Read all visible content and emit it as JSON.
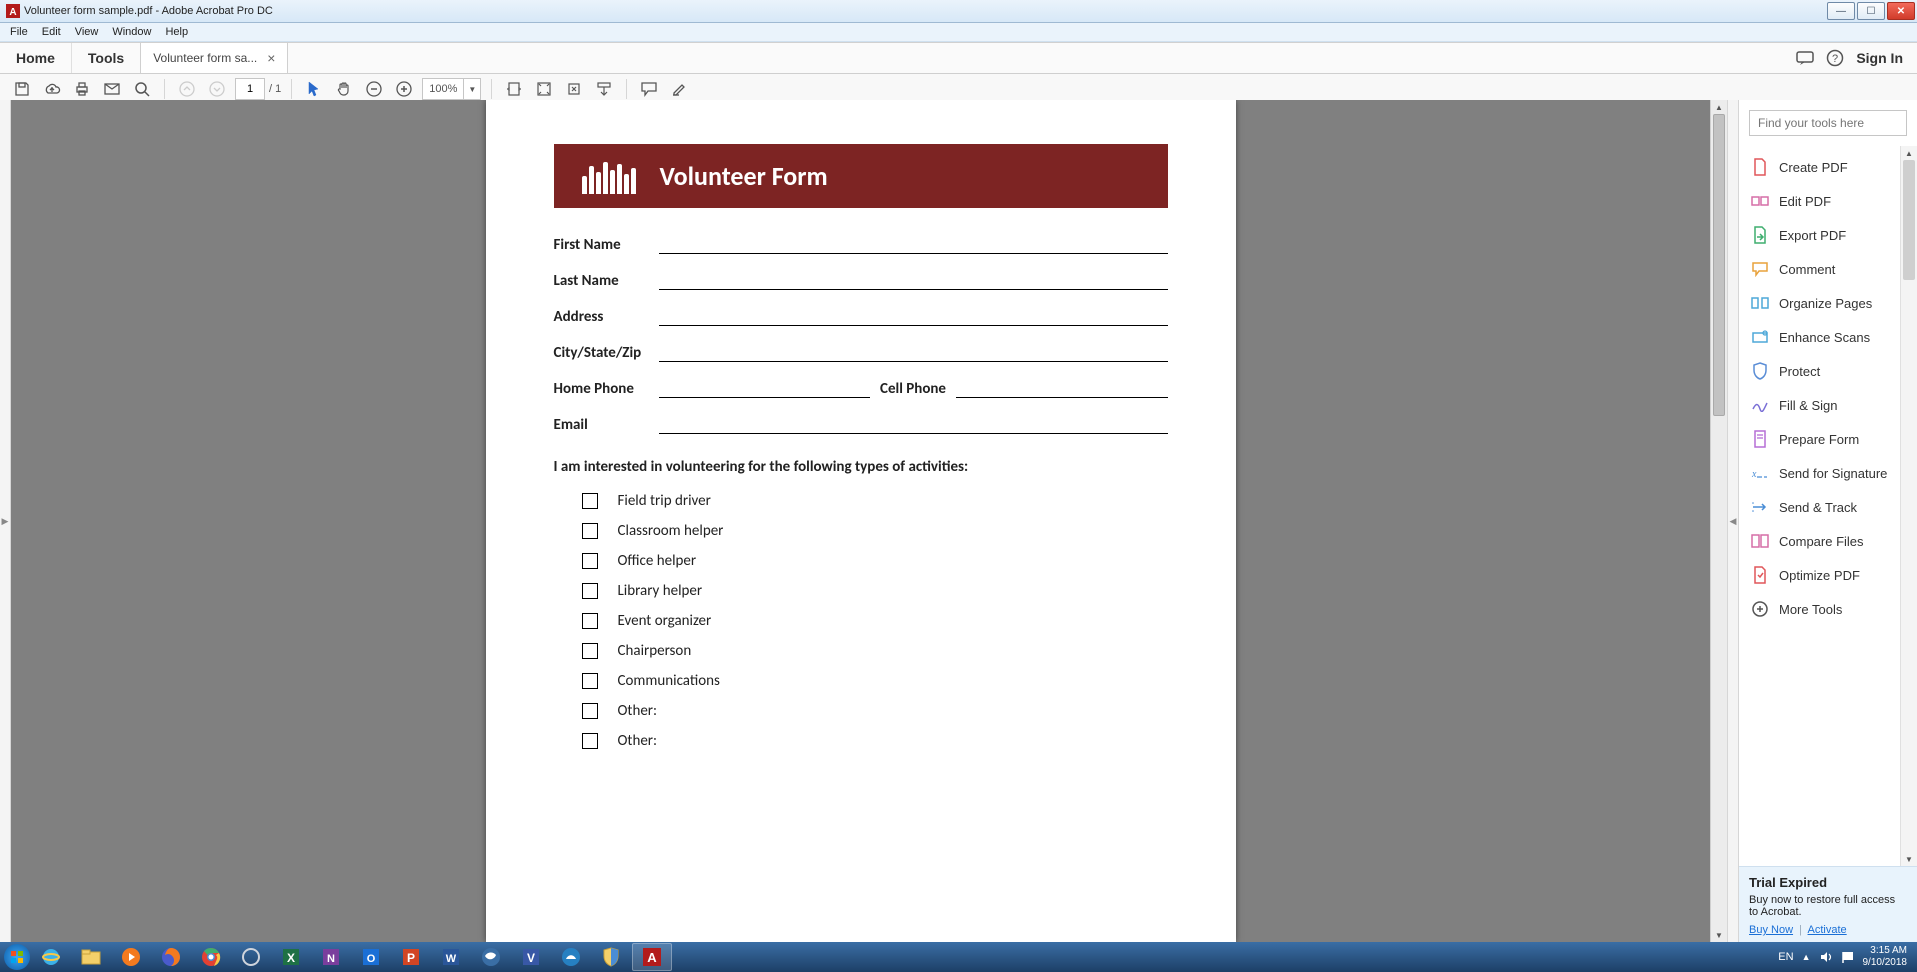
{
  "window": {
    "title": "Volunteer form sample.pdf - Adobe Acrobat Pro DC"
  },
  "menubar": [
    "File",
    "Edit",
    "View",
    "Window",
    "Help"
  ],
  "commandbar": {
    "home": "Home",
    "tools": "Tools",
    "tab_label": "Volunteer form sa...",
    "signin": "Sign In"
  },
  "toolbar": {
    "page_current": "1",
    "page_total": "/ 1",
    "zoom": "100%"
  },
  "pdf": {
    "banner_title": "Volunteer Form",
    "fields": {
      "first_name": "First Name",
      "last_name": "Last Name",
      "address": "Address",
      "city_state_zip": "City/State/Zip",
      "home_phone": "Home Phone",
      "cell_phone": "Cell Phone",
      "email": "Email"
    },
    "interest_heading": "I am interested in volunteering for the following types of activities:",
    "activities": [
      "Field trip driver",
      "Classroom helper",
      "Office helper",
      "Library helper",
      "Event organizer",
      "Chairperson",
      "Communications",
      "Other:",
      "Other:"
    ]
  },
  "tools_panel": {
    "search_placeholder": "Find your tools here",
    "items": [
      "Create PDF",
      "Edit PDF",
      "Export PDF",
      "Comment",
      "Organize Pages",
      "Enhance Scans",
      "Protect",
      "Fill & Sign",
      "Prepare Form",
      "Send for Signature",
      "Send & Track",
      "Compare Files",
      "Optimize PDF",
      "More Tools"
    ],
    "trial": {
      "title": "Trial Expired",
      "body": "Buy now to restore full access to Acrobat.",
      "buy": "Buy Now",
      "activate": "Activate"
    }
  },
  "systray": {
    "lang": "EN",
    "time": "3:15 AM",
    "date": "9/10/2018"
  }
}
